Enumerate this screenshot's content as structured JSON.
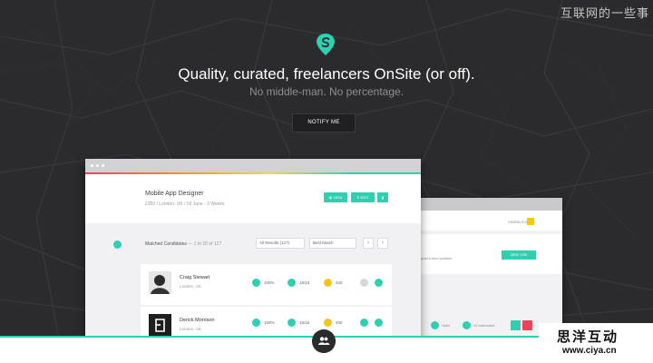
{
  "watermark_top": "互联网的一些事",
  "hero": {
    "headline": "Quality, curated, freelancers OnSite (or off).",
    "subline": "No middle-man. No percentage.",
    "notify_label": "NOTIFY ME"
  },
  "job": {
    "title": "Mobile App Designer",
    "meta": "£350 / London, UK / 03 June - 3 Weeks",
    "view_label": "VIEW",
    "edit_label": "EDIT"
  },
  "matched": {
    "label": "Matched Candidates",
    "range": "— 1 to 20 of 127",
    "filter_value": "All Results (127)",
    "sort_value": "Best Match"
  },
  "candidates": [
    {
      "name": "Craig Stewart",
      "location": "London, UK",
      "score": "100%",
      "tasks": "15/15",
      "rate": "340"
    },
    {
      "name": "Derick Morrison",
      "location": "London, UK",
      "score": "100%",
      "tasks": "15/15",
      "rate": "400"
    }
  ],
  "back_window": {
    "sidebar_label": "SIDEBLOCK",
    "position_text": "post a new position.",
    "new_job_label": "NEW JOB",
    "valid_label": "Valid",
    "interested_label": "12 Interested"
  },
  "watermark_bottom": {
    "cn": "思洋互动",
    "url": "www.ciya.cn"
  },
  "colors": {
    "accent": "#2dd0b0",
    "warning": "#f5c518",
    "danger": "#f0425a"
  }
}
